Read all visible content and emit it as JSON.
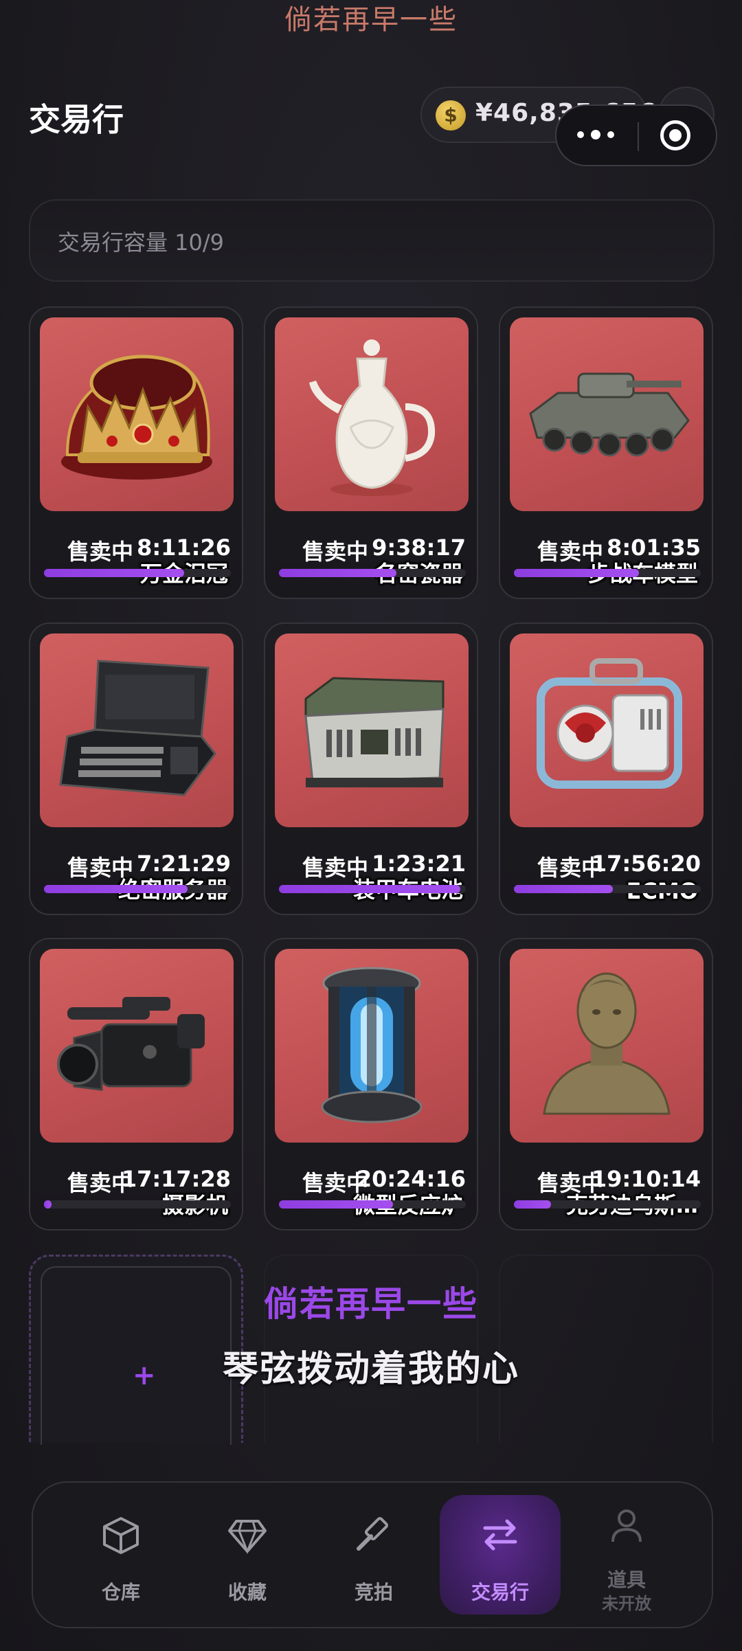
{
  "lyrics": {
    "top": "倘若再早一些",
    "line1": "倘若再早一些",
    "line2": "琴弦拨动着我的心"
  },
  "header": {
    "title": "交易行",
    "currency_symbol": "$",
    "balance": "¥46,835,656",
    "add_button": "+"
  },
  "capacity": {
    "label": "交易行容量 10/9"
  },
  "listings": [
    {
      "name": "万金泪冠",
      "status": "售卖中",
      "timer": "8:11:26",
      "progress": 0.75,
      "icon": "crown-icon"
    },
    {
      "name": "名窑瓷器",
      "status": "售卖中",
      "timer": "9:38:17",
      "progress": 0.63,
      "icon": "porcelain-ewer-icon"
    },
    {
      "name": "步战车模型",
      "status": "售卖中",
      "timer": "8:01:35",
      "progress": 0.67,
      "icon": "tank-model-icon"
    },
    {
      "name": "绝密服务器",
      "status": "售卖中",
      "timer": "7:21:29",
      "progress": 0.77,
      "icon": "server-case-icon"
    },
    {
      "name": "装甲车电池",
      "status": "售卖中",
      "timer": "1:23:21",
      "progress": 0.97,
      "icon": "battery-crate-icon"
    },
    {
      "name": "ECMO",
      "status": "售卖中",
      "timer": "17:56:20",
      "progress": 0.53,
      "icon": "ecmo-machine-icon"
    },
    {
      "name": "摄影机",
      "status": "售卖中",
      "timer": "17:17:28",
      "progress": 0.03,
      "icon": "video-camera-icon"
    },
    {
      "name": "微型反应炉",
      "status": "售卖中",
      "timer": "20:24:16",
      "progress": 0.61,
      "icon": "reactor-icon"
    },
    {
      "name": "克劳迪乌斯…",
      "status": "售卖中",
      "timer": "19:10:14",
      "progress": 0.2,
      "icon": "bust-statue-icon"
    }
  ],
  "empty_slot": {
    "plus": "+"
  },
  "tabs": [
    {
      "label": "仓库",
      "icon": "box-icon",
      "active": false
    },
    {
      "label": "收藏",
      "icon": "diamond-icon",
      "active": false
    },
    {
      "label": "竞拍",
      "icon": "gavel-icon",
      "active": false
    },
    {
      "label": "交易行",
      "icon": "swap-arrows-icon",
      "active": true
    },
    {
      "label": "道具",
      "sub": "未开放",
      "icon": "person-icon",
      "active": false
    }
  ],
  "colors": {
    "accent": "#a54ff0",
    "card_image_bg": "#c9585a",
    "background": "#1c1b20"
  }
}
